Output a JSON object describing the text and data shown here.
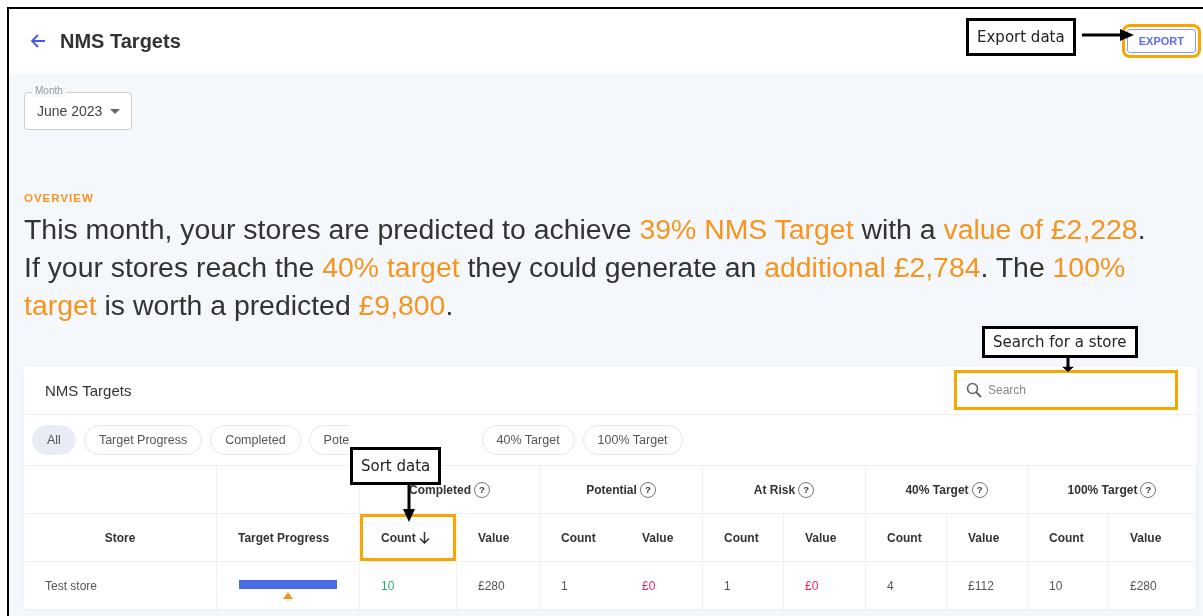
{
  "header": {
    "title": "NMS Targets",
    "export_button": {
      "label": "EXPORT",
      "highlighted": true
    }
  },
  "month_field": {
    "label": "Month",
    "value": "June 2023"
  },
  "overview": {
    "heading": "OVERVIEW",
    "segments": [
      {
        "text": "This month, your stores are predicted to achieve ",
        "accent": false
      },
      {
        "text": "39% NMS Target",
        "accent": true
      },
      {
        "text": " with a ",
        "accent": false
      },
      {
        "text": "value of £2,228",
        "accent": true
      },
      {
        "text": ". If your stores reach the ",
        "accent": false
      },
      {
        "text": "40% target",
        "accent": true
      },
      {
        "text": " they could generate an ",
        "accent": false
      },
      {
        "text": "additional £2,784",
        "accent": true
      },
      {
        "text": ". The ",
        "accent": false
      },
      {
        "text": "100% target",
        "accent": true
      },
      {
        "text": " is worth a predicted ",
        "accent": false
      },
      {
        "text": "£9,800",
        "accent": true
      },
      {
        "text": ".",
        "accent": false
      }
    ]
  },
  "table": {
    "title": "NMS Targets",
    "search": {
      "placeholder": "Search",
      "highlighted": true
    },
    "filters": [
      {
        "label": "All",
        "selected": true
      },
      {
        "label": "Target Progress",
        "selected": false
      },
      {
        "label": "Completed",
        "selected": false
      },
      {
        "label": "Pote",
        "selected": false
      },
      {
        "label": "40% Target",
        "selected": false
      },
      {
        "label": "100% Target",
        "selected": false
      }
    ],
    "fixed_columns": [
      "Store",
      "Target Progress"
    ],
    "groups": [
      {
        "label": "Completed",
        "help": "?",
        "subcolumns": [
          {
            "label": "Count",
            "sorted": true,
            "highlighted": true
          },
          {
            "label": "Value",
            "sorted": false,
            "highlighted": false
          }
        ]
      },
      {
        "label": "Potential",
        "help": "?",
        "subcolumns": [
          {
            "label": "Count",
            "sorted": false,
            "highlighted": false
          },
          {
            "label": "Value",
            "sorted": false,
            "highlighted": false
          }
        ]
      },
      {
        "label": "At Risk",
        "help": "?",
        "subcolumns": [
          {
            "label": "Count",
            "sorted": false,
            "highlighted": false
          },
          {
            "label": "Value",
            "sorted": false,
            "highlighted": false
          }
        ]
      },
      {
        "label": "40% Target",
        "help": "?",
        "subcolumns": [
          {
            "label": "Count",
            "sorted": false,
            "highlighted": false
          },
          {
            "label": "Value",
            "sorted": false,
            "highlighted": false
          }
        ]
      },
      {
        "label": "100% Target",
        "help": "?",
        "subcolumns": [
          {
            "label": "Count",
            "sorted": false,
            "highlighted": false
          },
          {
            "label": "Value",
            "sorted": false,
            "highlighted": false
          }
        ]
      }
    ],
    "rows": [
      {
        "store": "Test store",
        "progress": {
          "level": 1
        },
        "cells": [
          {
            "text": "10",
            "color": "#2eaa6b"
          },
          {
            "text": "£280",
            "color": "#555555"
          },
          {
            "text": "1",
            "color": "#555555"
          },
          {
            "text": "£0",
            "color": "#ea2463"
          },
          {
            "text": "1",
            "color": "#555555"
          },
          {
            "text": "£0",
            "color": "#ea2463"
          },
          {
            "text": "4",
            "color": "#555555"
          },
          {
            "text": "£112",
            "color": "#555555"
          },
          {
            "text": "10",
            "color": "#555555"
          },
          {
            "text": "£280",
            "color": "#555555"
          }
        ]
      }
    ]
  },
  "annotations": [
    {
      "kind": "export",
      "text": "Export data"
    },
    {
      "kind": "search",
      "text": "Search for a store"
    },
    {
      "kind": "sort",
      "text": "Sort data"
    }
  ]
}
